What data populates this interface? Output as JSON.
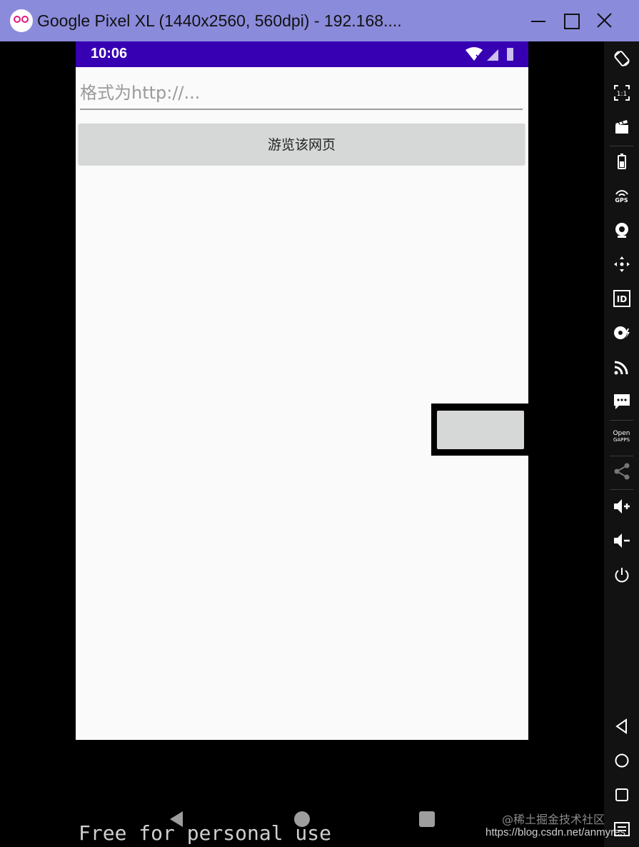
{
  "window": {
    "title": "Google Pixel XL (1440x2560, 560dpi) - 192.168...."
  },
  "statusbar": {
    "time": "10:06"
  },
  "app": {
    "url_placeholder": "格式为http://...",
    "browse_button_label": "游览该网页"
  },
  "toolbar": {
    "items": [
      {
        "name": "rotate-icon"
      },
      {
        "name": "fit-1-1-icon"
      },
      {
        "name": "screen-record-icon"
      },
      {
        "name": "battery-icon"
      },
      {
        "name": "gps-icon",
        "label": "GPS"
      },
      {
        "name": "camera-icon"
      },
      {
        "name": "move-icon"
      },
      {
        "name": "id-icon",
        "label": "ID"
      },
      {
        "name": "disk-icon"
      },
      {
        "name": "cast-icon"
      },
      {
        "name": "sms-icon"
      },
      {
        "name": "open-gapps-icon",
        "label_line1": "Open",
        "label_line2": "GAPPS"
      },
      {
        "name": "share-icon"
      },
      {
        "name": "volume-up-icon"
      },
      {
        "name": "volume-down-icon"
      },
      {
        "name": "power-icon"
      },
      {
        "name": "back-icon"
      },
      {
        "name": "home-icon"
      },
      {
        "name": "recents-icon"
      },
      {
        "name": "menu-icon"
      }
    ]
  },
  "watermarks": {
    "free": "Free for personal use",
    "juejin": "@稀土掘金技术社区",
    "csdn": "https://blog.csdn.net/anmyres"
  },
  "colors": {
    "titlebar": "#8b8bdc",
    "statusbar": "#3700b3",
    "app_background": "#fafafa",
    "button": "#d6d7d7"
  }
}
